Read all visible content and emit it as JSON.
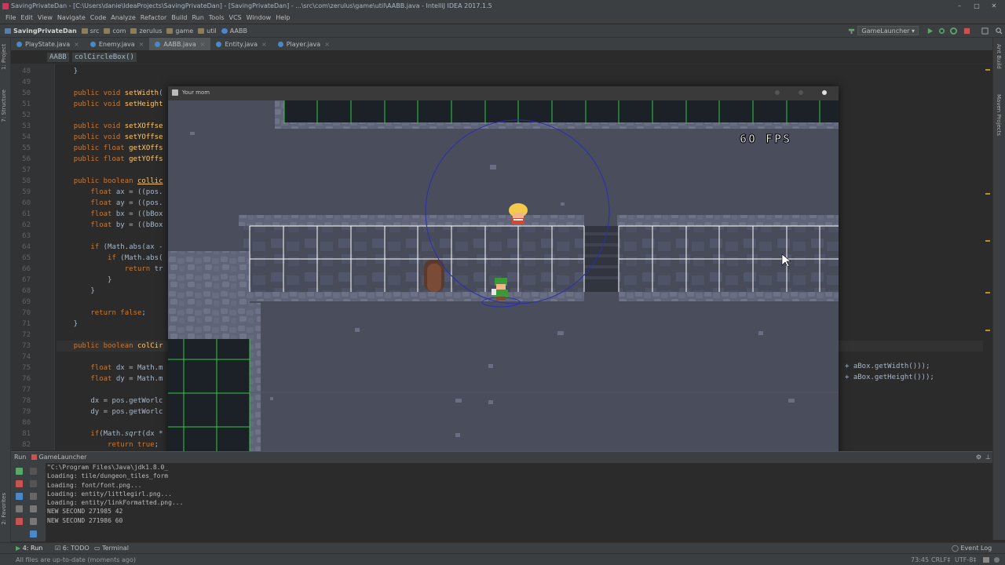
{
  "window": {
    "title": "SavingPrivateDan - [C:\\Users\\danie\\IdeaProjects\\SavingPrivateDan] - [SavingPrivateDan] - ...\\src\\com\\zerulus\\game\\util\\AABB.java - IntelliJ IDEA 2017.1.5"
  },
  "menu": [
    "File",
    "Edit",
    "View",
    "Navigate",
    "Code",
    "Analyze",
    "Refactor",
    "Build",
    "Run",
    "Tools",
    "VCS",
    "Window",
    "Help"
  ],
  "navbar": {
    "crumbs": [
      "SavingPrivateDan",
      "src",
      "com",
      "zerulus",
      "game",
      "util",
      "AABB"
    ],
    "run_config": "GameLauncher"
  },
  "tabs": [
    {
      "label": "PlayState.java"
    },
    {
      "label": "Enemy.java"
    },
    {
      "label": "AABB.java"
    },
    {
      "label": "Entity.java"
    },
    {
      "label": "Player.java"
    }
  ],
  "editor_breadcrumb": {
    "class": "AABB",
    "method": "colCircleBox()"
  },
  "left_strip": [
    "1: Project",
    "7: Structure",
    "2: Favorites"
  ],
  "right_strip": [
    "Ant Build",
    "Maven Projects"
  ],
  "code": {
    "line_numbers": [
      "48",
      "49",
      "50",
      "51",
      "52",
      "53",
      "54",
      "55",
      "56",
      "57",
      "58",
      "59",
      "60",
      "61",
      "62",
      "63",
      "64",
      "65",
      "66",
      "67",
      "68",
      "69",
      "70",
      "71",
      "72",
      "73",
      "74",
      "75",
      "76",
      "77",
      "78",
      "79",
      "80",
      "81"
    ],
    "lines": [
      {
        "n": "48",
        "t": "    }"
      },
      {
        "n": "49",
        "t": ""
      },
      {
        "n": "50",
        "t": "    public void setWidth("
      },
      {
        "n": "51",
        "t": "    public void setHeight"
      },
      {
        "n": "52",
        "t": ""
      },
      {
        "n": "53",
        "t": "    public void setXOffse"
      },
      {
        "n": "54",
        "t": "    public void setYOffse"
      },
      {
        "n": "55",
        "t": "    public float getXOffs"
      },
      {
        "n": "56",
        "t": "    public float getYOffs"
      },
      {
        "n": "57",
        "t": ""
      },
      {
        "n": "58",
        "t": "    public boolean collic"
      },
      {
        "n": "59",
        "t": "        float ax = ((pos."
      },
      {
        "n": "60",
        "t": "        float ay = ((pos."
      },
      {
        "n": "61",
        "t": "        float bx = ((bBox"
      },
      {
        "n": "62",
        "t": "        float by = ((bBox"
      },
      {
        "n": "63",
        "t": ""
      },
      {
        "n": "64",
        "t": "        if (Math.abs(ax -"
      },
      {
        "n": "65",
        "t": "            if (Math.abs("
      },
      {
        "n": "66",
        "t": "                return tr"
      },
      {
        "n": "67",
        "t": "            }"
      },
      {
        "n": "68",
        "t": "        }"
      },
      {
        "n": "69",
        "t": ""
      },
      {
        "n": "70",
        "t": "        return false;"
      },
      {
        "n": "71",
        "t": "    }"
      },
      {
        "n": "72",
        "t": ""
      },
      {
        "n": "73",
        "t": "    public boolean colCir"
      },
      {
        "n": "74",
        "t": ""
      },
      {
        "n": "75",
        "t": "        float dx = Math.m"
      },
      {
        "n": "76",
        "t": "        float dy = Math.m"
      },
      {
        "n": "77",
        "t": ""
      },
      {
        "n": "78",
        "t": "        dx = pos.getWorlc"
      },
      {
        "n": "79",
        "t": "        dy = pos.getWorlc"
      },
      {
        "n": "80",
        "t": ""
      },
      {
        "n": "81",
        "t": "        if(Math.sqrt(dx *"
      },
      {
        "n": "82",
        "t": "            return true;"
      }
    ],
    "right_fragments": [
      "+ aBox.getWidth()));",
      "+ aBox.getHeight()));"
    ]
  },
  "game_window": {
    "title": "Your mom",
    "fps_text": "60 FPS"
  },
  "run_panel": {
    "tab_label": "Run",
    "config_label": "GameLauncher",
    "console": [
      "\"C:\\Program Files\\Java\\jdk1.8.0_",
      "Loading: tile/dungeon_tiles_form",
      "Loading: font/font.png...",
      "Loading: entity/littlegirl.png...",
      "Loading: entity/linkFormatted.png...",
      "NEW SECOND 271985 42",
      "NEW SECOND 271986 60"
    ]
  },
  "bottom_tools": [
    "4: Run",
    "6: TODO",
    "Terminal"
  ],
  "event_log": "Event Log",
  "status": {
    "message": "All files are up-to-date (moments ago)",
    "position": "73:45",
    "line_sep": "CRLF‡",
    "encoding": "UTF-8‡"
  },
  "colors": {
    "ide_bg": "#2b2b2b",
    "keyword": "#cc7832",
    "method": "#ffc66d",
    "game_floor": "#4a4d5c",
    "grid_green": "#2ecc40"
  }
}
